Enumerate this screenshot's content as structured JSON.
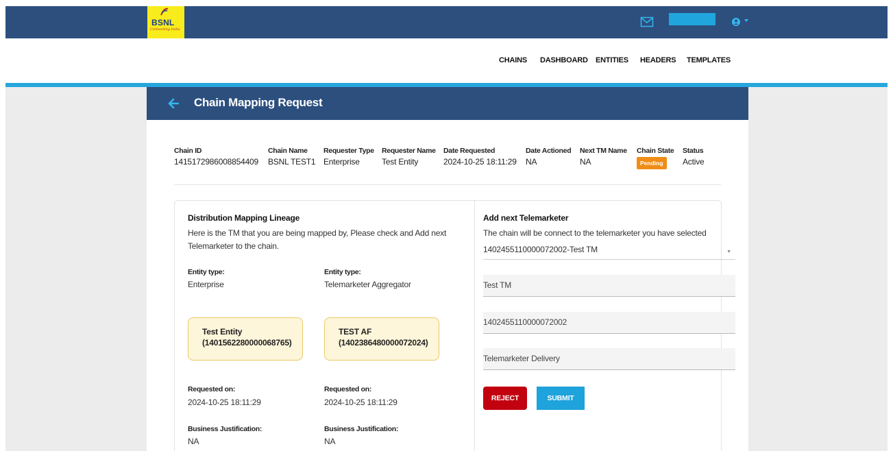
{
  "header": {
    "logo_name": "BSNL",
    "logo_tagline": "Connecting India",
    "icons": [
      "mail-icon",
      "avatar-icon",
      "caret-down-icon"
    ],
    "accent_color": "#2c4f7e"
  },
  "nav": {
    "items": [
      "CHAINS",
      "DASHBOARD",
      "ENTITIES",
      "HEADERS",
      "TEMPLATES"
    ]
  },
  "page": {
    "title": "Chain Mapping Request"
  },
  "summary": {
    "columns": [
      {
        "label": "Chain ID",
        "value": "1415172986008854409"
      },
      {
        "label": "Chain Name",
        "value": "BSNL TEST1"
      },
      {
        "label": "Requester Type",
        "value": "Enterprise"
      },
      {
        "label": "Requester Name",
        "value": "Test Entity"
      },
      {
        "label": "Date Requested",
        "value": "2024-10-25 18:11:29"
      },
      {
        "label": "Date Actioned",
        "value": "NA"
      },
      {
        "label": "Next TM Name",
        "value": "NA"
      },
      {
        "label": "Chain State",
        "value": "Pending"
      },
      {
        "label": "Status",
        "value": "Active"
      }
    ],
    "badge_color": "#f08d16"
  },
  "lineage": {
    "heading": "Distribution Mapping Lineage",
    "desc_line1": "Here is the TM that you are being mapped by, Please check and Add next",
    "desc_line2": "Telemarketer to the chain.",
    "left": {
      "entity_type_label": "Entity type:",
      "entity_type": "Enterprise",
      "node_title": "Test Entity",
      "node_id": "(1401562280000068765)",
      "requested_label": "Requested on:",
      "requested_value": "2024-10-25 18:11:29",
      "justification_label": "Business Justification:",
      "justification_value": "NA"
    },
    "right": {
      "entity_type_label": "Entity type:",
      "entity_type": "Telemarketer Aggregator",
      "node_title": "TEST AF",
      "node_id": "(1402386480000072024)",
      "requested_label": "Requested on:",
      "requested_value": "2024-10-25 18:11:29",
      "justification_label": "Business Justification:",
      "justification_value": "NA"
    }
  },
  "add_tm": {
    "heading": "Add next Telemarketer",
    "desc": "The chain will be connect to the telemarketer you have selected",
    "select_value": "1402455110000072002-Test TM",
    "field_name": "Test TM",
    "field_id": "1402455110000072002",
    "field_type": "Telemarketer Delivery",
    "reject_label": "REJECT",
    "submit_label": "SUBMIT",
    "reject_color": "#c2020f",
    "submit_color": "#1ea3dc"
  }
}
